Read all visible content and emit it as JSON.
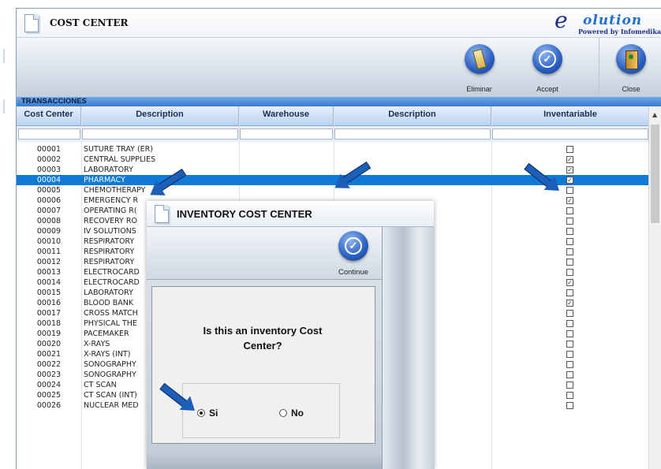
{
  "window": {
    "title": "COST CENTER"
  },
  "logo": {
    "letter": "e",
    "word": "olution",
    "tagline": "Powered by Infomedika"
  },
  "toolbar": {
    "eliminar_label": "Eliminar",
    "accept_label": "Accept",
    "close_label": "Close"
  },
  "section": {
    "title": "TRANSACCIONES"
  },
  "grid": {
    "columns": [
      "Cost Center",
      "Description",
      "Warehouse",
      "Description",
      "Inventariable"
    ],
    "selected_row_index": 3,
    "rows": [
      {
        "code": "00001",
        "desc": "SUTURE TRAY (ER)",
        "checked": false
      },
      {
        "code": "00002",
        "desc": "CENTRAL SUPPLIES",
        "checked": true
      },
      {
        "code": "00003",
        "desc": "LABORATORY",
        "checked": true
      },
      {
        "code": "00004",
        "desc": "PHARMACY",
        "checked": true
      },
      {
        "code": "00005",
        "desc": "CHEMOTHERAPY",
        "checked": false
      },
      {
        "code": "00006",
        "desc": "EMERGENCY R",
        "checked": true
      },
      {
        "code": "00007",
        "desc": "OPERATING R(",
        "checked": false
      },
      {
        "code": "00008",
        "desc": "RECOVERY RO",
        "checked": false
      },
      {
        "code": "00009",
        "desc": "IV SOLUTIONS",
        "checked": false
      },
      {
        "code": "00010",
        "desc": "RESPIRATORY",
        "checked": false
      },
      {
        "code": "00011",
        "desc": "RESPIRATORY",
        "checked": false
      },
      {
        "code": "00012",
        "desc": "RESPIRATORY",
        "checked": false
      },
      {
        "code": "00013",
        "desc": "ELECTROCARD",
        "checked": false
      },
      {
        "code": "00014",
        "desc": "ELECTROCARD",
        "checked": true
      },
      {
        "code": "00015",
        "desc": "LABORATORY",
        "checked": false
      },
      {
        "code": "00016",
        "desc": "BLOOD BANK",
        "checked": true
      },
      {
        "code": "00017",
        "desc": "CROSS MATCH",
        "checked": false
      },
      {
        "code": "00018",
        "desc": "PHYSICAL THE",
        "checked": false
      },
      {
        "code": "00019",
        "desc": "PACEMAKER",
        "checked": false
      },
      {
        "code": "00020",
        "desc": "X-RAYS",
        "checked": false
      },
      {
        "code": "00021",
        "desc": "X-RAYS (INT)",
        "checked": false
      },
      {
        "code": "00022",
        "desc": "SONOGRAPHY",
        "checked": false
      },
      {
        "code": "00023",
        "desc": "SONOGRAPHY",
        "checked": false
      },
      {
        "code": "00024",
        "desc": "CT SCAN",
        "checked": false
      },
      {
        "code": "00025",
        "desc": "CT SCAN (INT)",
        "checked": false
      },
      {
        "code": "00026",
        "desc": "NUCLEAR MED",
        "checked": false
      }
    ]
  },
  "dialog": {
    "title": "INVENTORY COST CENTER",
    "continue_label": "Continue",
    "question_line1": "Is this an inventory Cost",
    "question_line2": "Center?",
    "option_yes": "Si",
    "option_no": "No",
    "selected": "Si"
  },
  "colors": {
    "selection": "#0e7ad6",
    "accent": "#2a5fc0",
    "annotation_arrow": "#1d5fb8"
  }
}
